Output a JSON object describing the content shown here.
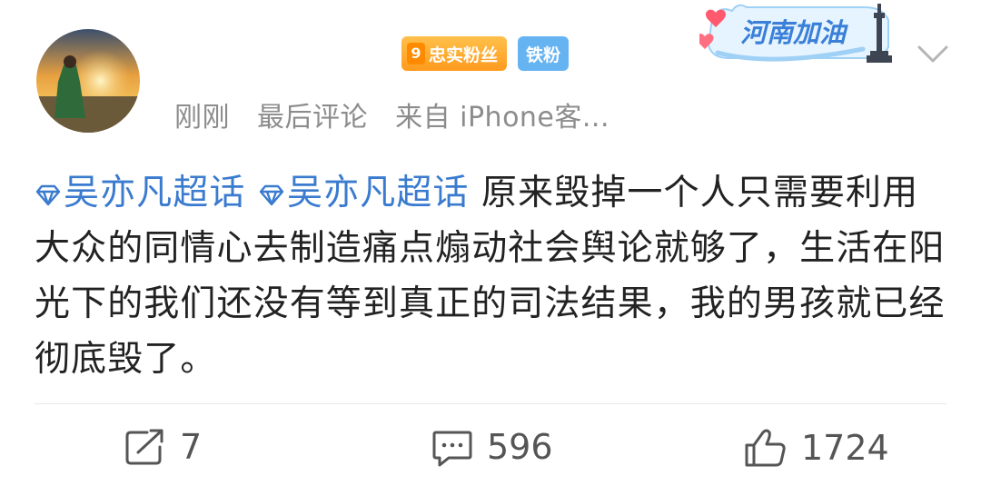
{
  "user": {
    "badges": {
      "fan_level": "9",
      "fan_label": "忠实粉丝",
      "tie_label": "铁粉"
    }
  },
  "campaign_banner": {
    "text": "河南加油"
  },
  "meta": {
    "time": "刚刚",
    "type": "最后评论",
    "source": "来自 iPhone客..."
  },
  "post": {
    "tags": [
      "吴亦凡超话",
      "吴亦凡超话"
    ],
    "body": "原来毁掉一个人只需要利用大众的同情心去制造痛点煽动社会舆论就够了，生活在阳光下的我们还没有等到真正的司法结果，我的男孩就已经彻底毁了。"
  },
  "actions": {
    "repost_count": "7",
    "comment_count": "596",
    "like_count": "1724"
  },
  "colors": {
    "tag": "#3a7bcf",
    "fan_badge": "#ff9b1e",
    "tie_badge": "#66b3f2",
    "meta_text": "#8c8c8c"
  }
}
